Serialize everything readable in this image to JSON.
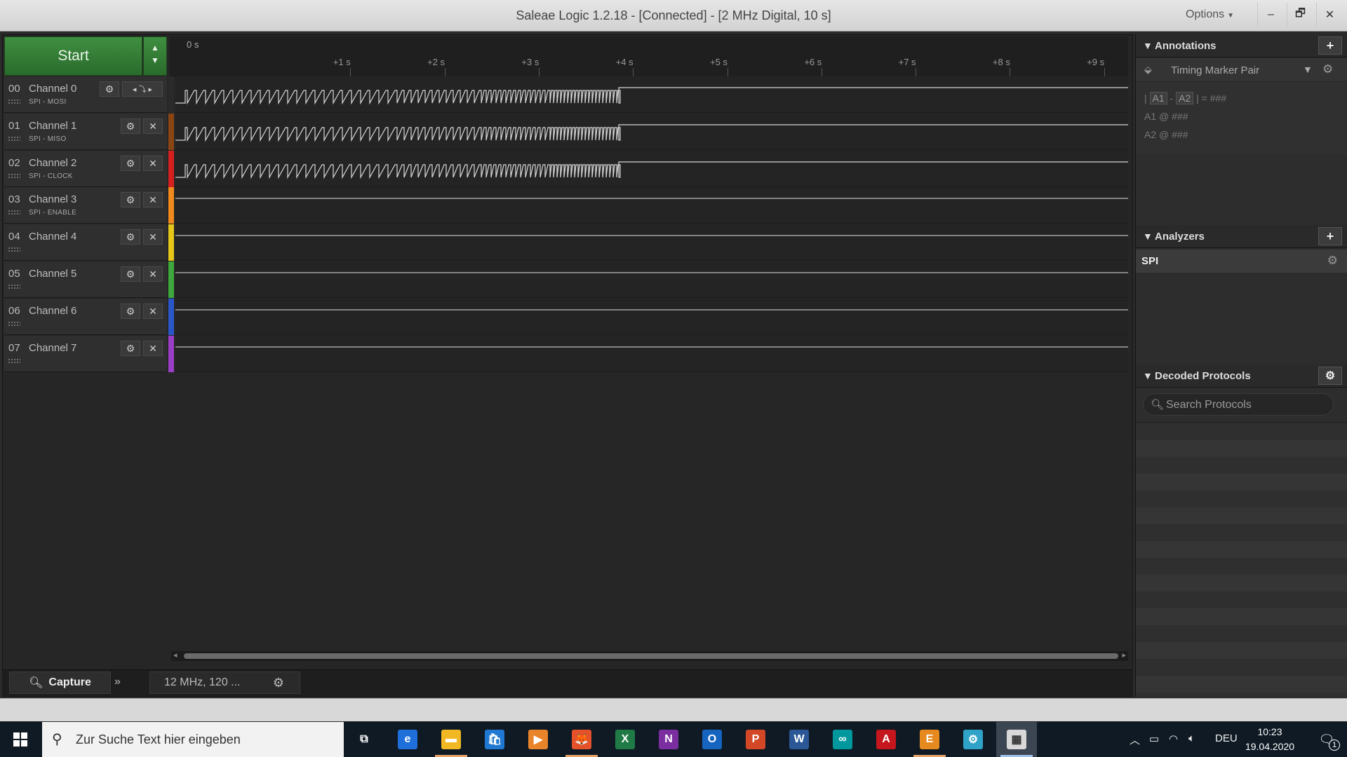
{
  "window": {
    "title": "Saleae Logic 1.2.18 - [Connected] - [2 MHz Digital, 10 s]",
    "options_label": "Options",
    "minimize": "–",
    "restore": "🗗",
    "close": "✕"
  },
  "toolbar": {
    "start_label": "Start"
  },
  "ruler": {
    "origin_label": "0 s",
    "ticks": [
      "+1 s",
      "+2 s",
      "+3 s",
      "+4 s",
      "+5 s",
      "+6 s",
      "+7 s",
      "+8 s",
      "+9 s"
    ]
  },
  "channels": [
    {
      "num": "00",
      "name": "Channel 0",
      "sub": "SPI - MOSI",
      "color": "#2a2a2a",
      "active": true
    },
    {
      "num": "01",
      "name": "Channel 1",
      "sub": "SPI - MISO",
      "color": "#8b4513",
      "active": true
    },
    {
      "num": "02",
      "name": "Channel 2",
      "sub": "SPI - CLOCK",
      "color": "#d62020",
      "active": true
    },
    {
      "num": "03",
      "name": "Channel 3",
      "sub": "SPI - ENABLE",
      "color": "#f08a1c",
      "active": false
    },
    {
      "num": "04",
      "name": "Channel 4",
      "sub": "",
      "color": "#e6c619",
      "active": false
    },
    {
      "num": "05",
      "name": "Channel 5",
      "sub": "",
      "color": "#3ea83e",
      "active": false
    },
    {
      "num": "06",
      "name": "Channel 6",
      "sub": "",
      "color": "#2a56c8",
      "active": false
    },
    {
      "num": "07",
      "name": "Channel 7",
      "sub": "",
      "color": "#9a3ec8",
      "active": false
    }
  ],
  "bottom": {
    "capture_label": "Capture",
    "more_label": "»",
    "rate_label": "12 MHz, 120 ..."
  },
  "annotations": {
    "header": "Annotations",
    "marker_label": "Timing Marker Pair",
    "line1": {
      "bar1": "|",
      "a1": "A1",
      "dash": "-",
      "a2": "A2",
      "bar2": "|",
      "eq": "=",
      "val": "###"
    },
    "line2": {
      "name": "A1",
      "at": "@",
      "val": "###"
    },
    "line3": {
      "name": "A2",
      "at": "@",
      "val": "###"
    }
  },
  "analyzers": {
    "header": "Analyzers",
    "items": [
      "SPI"
    ]
  },
  "decoded": {
    "header": "Decoded Protocols",
    "search_placeholder": "Search Protocols"
  },
  "taskbar": {
    "search_placeholder": "Zur Suche Text hier eingeben",
    "lang": "DEU",
    "time": "10:23",
    "date": "19.04.2020",
    "notifications": "1",
    "apps": [
      {
        "name": "task-view",
        "glyph": "⧉",
        "bg": "transparent"
      },
      {
        "name": "edge",
        "glyph": "e",
        "bg": "#1e6fd9"
      },
      {
        "name": "file-explorer",
        "glyph": "▬",
        "bg": "#f2b824"
      },
      {
        "name": "store",
        "glyph": "🛍",
        "bg": "#1f78d1"
      },
      {
        "name": "media",
        "glyph": "▶",
        "bg": "#e8842a"
      },
      {
        "name": "firefox",
        "glyph": "🦊",
        "bg": "#e5522a"
      },
      {
        "name": "excel",
        "glyph": "X",
        "bg": "#1f7a45"
      },
      {
        "name": "onenote",
        "glyph": "N",
        "bg": "#7a2ea0"
      },
      {
        "name": "outlook",
        "glyph": "O",
        "bg": "#1565c0"
      },
      {
        "name": "powerpoint",
        "glyph": "P",
        "bg": "#d24726"
      },
      {
        "name": "word",
        "glyph": "W",
        "bg": "#2b5797"
      },
      {
        "name": "arduino",
        "glyph": "∞",
        "bg": "#00979d"
      },
      {
        "name": "acrobat",
        "glyph": "A",
        "bg": "#c4161c"
      },
      {
        "name": "eagle",
        "glyph": "E",
        "bg": "#e68a1f"
      },
      {
        "name": "settings-app",
        "glyph": "⚙",
        "bg": "#2fa2c7"
      },
      {
        "name": "saleae-logic",
        "glyph": "▦",
        "bg": "#d8d8d8"
      }
    ]
  }
}
